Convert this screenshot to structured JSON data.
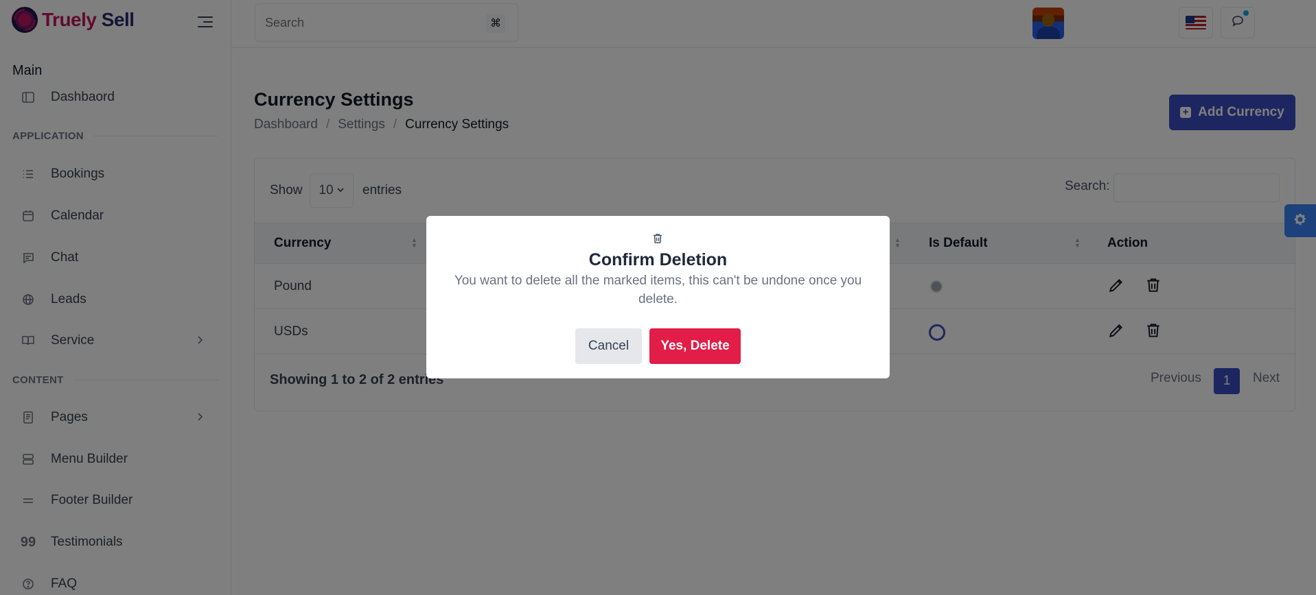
{
  "brand": {
    "name_part1": "Truely",
    "name_part2": "Sell"
  },
  "sidebar": {
    "section_main": "Main",
    "dashboard": "Dashbaord",
    "category_application": "APPLICATION",
    "items_application": [
      {
        "label": "Bookings",
        "icon": "list-icon"
      },
      {
        "label": "Calendar",
        "icon": "calendar-icon"
      },
      {
        "label": "Chat",
        "icon": "chat-icon"
      },
      {
        "label": "Leads",
        "icon": "globe-icon"
      },
      {
        "label": "Service",
        "icon": "book-icon"
      }
    ],
    "category_content": "CONTENT",
    "items_content": [
      {
        "label": "Pages",
        "icon": "page-icon"
      },
      {
        "label": "Menu Builder",
        "icon": "menu-icon"
      },
      {
        "label": "Footer Builder",
        "icon": "lines-icon"
      },
      {
        "label": "Testimonials",
        "icon": "quote-icon"
      },
      {
        "label": "FAQ",
        "icon": "help-icon"
      }
    ]
  },
  "header": {
    "search_placeholder": "Search",
    "shortcut_key": "⌘"
  },
  "page": {
    "title": "Currency Settings",
    "breadcrumb": [
      "Dashboard",
      "Settings",
      "Currency Settings"
    ],
    "add_button": "Add Currency"
  },
  "table": {
    "show_label": "Show",
    "page_length": "10",
    "entries_label": "entries",
    "search_label": "Search:",
    "columns": [
      "Currency",
      "Is Default",
      "Action"
    ],
    "rows": [
      {
        "currency": "Pound",
        "is_default": true
      },
      {
        "currency": "USDs",
        "is_default": false
      }
    ],
    "showing": "Showing 1 to 2 of 2 entries",
    "previous": "Previous",
    "current_page": "1",
    "next": "Next"
  },
  "modal": {
    "title": "Confirm Deletion",
    "message": "You want to delete all the marked items, this can't be undone once you delete.",
    "cancel": "Cancel",
    "confirm": "Yes, Delete"
  },
  "colors": {
    "primary": "#3b4cc0",
    "danger": "#e11d48",
    "brand_magenta": "#c0175d",
    "brand_navy": "#2b2a6e"
  }
}
